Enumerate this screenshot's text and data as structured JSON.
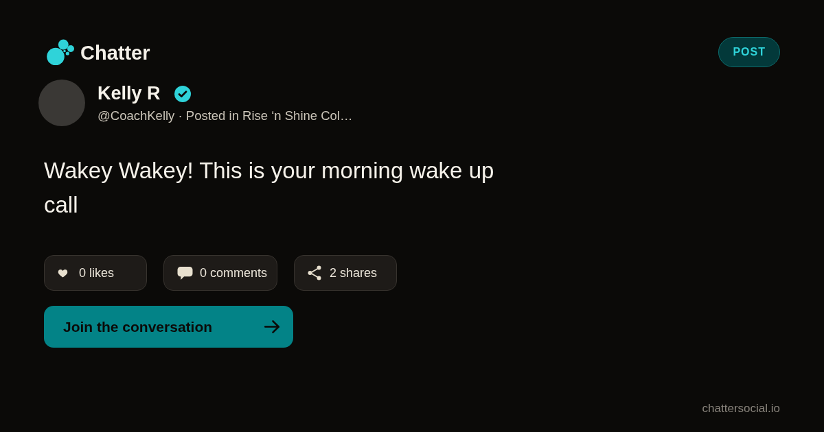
{
  "brand": {
    "name": "Chatter"
  },
  "badge": {
    "label": "POST"
  },
  "author": {
    "name": "Kelly R",
    "verified": true,
    "meta": "@CoachKelly · Posted in Rise ‘n Shine Col…"
  },
  "post": {
    "text": "Wakey Wakey! This is your morning wake up call"
  },
  "stats": [
    {
      "kind": "likes",
      "label": "0 likes"
    },
    {
      "kind": "comments",
      "label": "0 comments"
    },
    {
      "kind": "shares",
      "label": "2 shares"
    }
  ],
  "cta": {
    "label": "Join the conversation"
  },
  "footer": {
    "domain": "chattersocial.io"
  }
}
